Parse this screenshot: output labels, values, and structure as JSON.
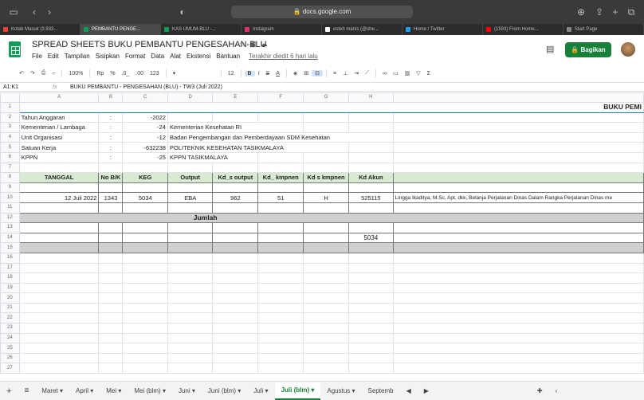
{
  "browser": {
    "url": "docs.google.com",
    "tabs": [
      {
        "label": "Kotak Masuk (3.933...",
        "color": "#ea4335"
      },
      {
        "label": "PEMBANTU PENGE...",
        "color": "#0f9d58"
      },
      {
        "label": "KAS UMUM-BLU -...",
        "color": "#0f9d58"
      },
      {
        "label": "Instagram",
        "color": "#e1306c"
      },
      {
        "label": "esteh manis (@she...",
        "color": "#ffffff"
      },
      {
        "label": "Home / Twitter",
        "color": "#1da1f2"
      },
      {
        "label": "(1593) From Home...",
        "color": "#ff0000"
      },
      {
        "label": "Start Page",
        "color": "#888888"
      }
    ]
  },
  "doc": {
    "title": "SPREAD SHEETS BUKU PEMBANTU PENGESAHAN-BLU",
    "menus": [
      "File",
      "Edit",
      "Tampilan",
      "Sisipkan",
      "Format",
      "Data",
      "Alat",
      "Ekstensi",
      "Bantuan"
    ],
    "last_edit": "Terakhir diedit 6 hari lalu",
    "share_label": "Bagikan"
  },
  "toolbar": {
    "zoom": "100%",
    "currency": "Rp",
    "percent": "%",
    "dec_less": ".0_",
    "dec_more": ".00",
    "format": "123",
    "font_size": "12"
  },
  "formula": {
    "namebox": "A1:K1",
    "fx": "fx",
    "value": "BUKU PEMBANTU - PENGESAHAN (BLU) - TW3 (Juli 2022)"
  },
  "grid": {
    "columns": [
      "A",
      "B",
      "C",
      "D",
      "E",
      "F",
      "G",
      "H"
    ],
    "row_numbers": [
      "1",
      "2",
      "3",
      "4",
      "5",
      "6",
      "7",
      "8",
      "9",
      "10",
      "11",
      "12",
      "13",
      "14",
      "15",
      "16",
      "17",
      "18",
      "19",
      "20",
      "21",
      "22",
      "23",
      "24",
      "25",
      "26",
      "27"
    ],
    "r1_title": "BUKU PEMI",
    "info": [
      {
        "label": "Tahun Anggaran",
        "colon": ":",
        "num": "-2022",
        "text": ""
      },
      {
        "label": "Kementerian / Lambaga",
        "colon": ":",
        "num": "-24",
        "text": "Kementerian Kesehatan RI"
      },
      {
        "label": "Unit Organisasi",
        "colon": ":",
        "num": "-12",
        "text": "Badan Pengembangan dan Pemberdayaan SDM Kesehatan"
      },
      {
        "label": "Satuan Kerja",
        "colon": ":",
        "num": "-632238",
        "text": "POLITEKNIK KESEHATAN TASIKMALAYA"
      },
      {
        "label": "KPPN",
        "colon": ":",
        "num": "-25",
        "text": "KPPN TASIKMALAYA"
      }
    ],
    "headers": [
      "TANGGAL",
      "No B/K",
      "KEG",
      "Output",
      "Kd_s output",
      "Kd_ kmpnen",
      "Kd s kmpnen",
      "Kd Akun"
    ],
    "row10": [
      "12 Juli 2022",
      "1343",
      "5034",
      "EBA",
      "962",
      "51",
      "H",
      "525115",
      "Lingga Ikaditya, M.Sc, Apt, dkk, Belanja Perjalanan Dinas Dalam Rangka Perjalanan Dinas me"
    ],
    "jumlah": "Jumlah",
    "row14_h": "5034"
  },
  "sheets": [
    "Maret",
    "April",
    "Mei",
    "Mei (blm)",
    "Juni",
    "Juni (blm)",
    "Juli",
    "Juli (blm)",
    "Agustus",
    "Septemb"
  ],
  "active_sheet": "Juli (blm)"
}
